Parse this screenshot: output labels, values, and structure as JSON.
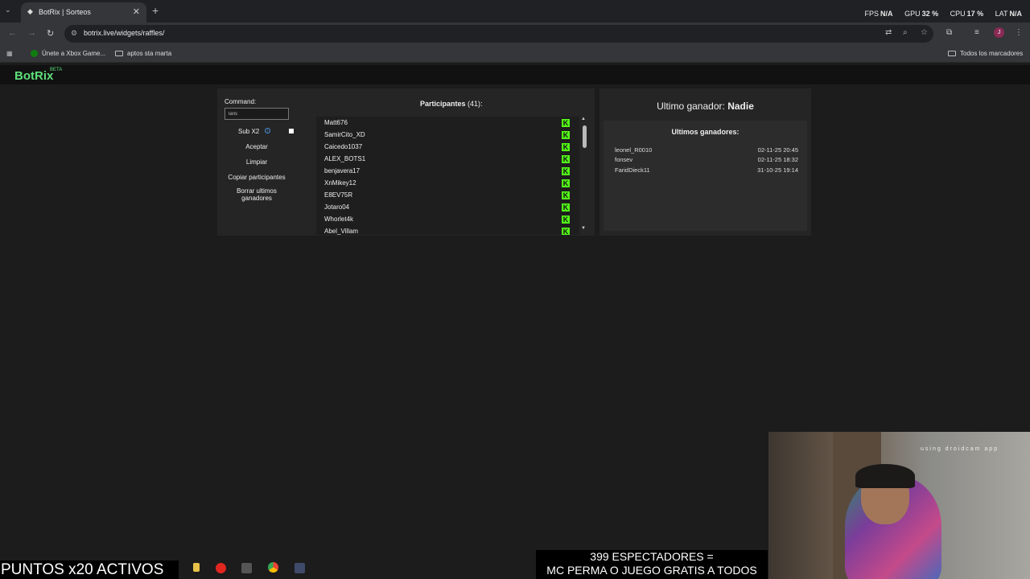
{
  "browser": {
    "tab_title": "BotRix | Sorteos",
    "url": "botrix.live/widgets/raffles/",
    "stats": [
      {
        "label": "FPS",
        "value": "N/A"
      },
      {
        "label": "GPU",
        "value": "32 %"
      },
      {
        "label": "CPU",
        "value": "17 %"
      },
      {
        "label": "LAT",
        "value": "N/A"
      }
    ],
    "bookmarks": {
      "xbox": "Únete a Xbox Game...",
      "folder1": "aptos sta marta",
      "all": "Todos los marcadores"
    },
    "avatar_letter": "J"
  },
  "app": {
    "logo": "BotRix",
    "beta": "BETA"
  },
  "left": {
    "command_label": "Command:",
    "command_value": "laris",
    "sub_x2_label": "Sub X2",
    "accept": "Aceptar",
    "clear": "Limpiar",
    "copy": "Copiar participantes",
    "delete": "Borrar ultimos ganadores"
  },
  "participants": {
    "title": "Participantes",
    "count": "(41)",
    "colon": ":",
    "names": [
      "Matt676",
      "SamirCito_XD",
      "Caicedo1037",
      "ALEX_BOTS1",
      "benjavera17",
      "XnMikey12",
      "E8EV75R",
      "Jotaro04",
      "Whorlet4k",
      "Abel_Villam"
    ]
  },
  "right": {
    "last_winner_label": "Ultimo ganador:",
    "last_winner_value": "Nadie",
    "winners_title": "Ultimos ganadores:",
    "winners": [
      {
        "name": "leonel_R0010",
        "date": "02-11-25 20:45"
      },
      {
        "name": "fonsev",
        "date": "02-11-25 18:32"
      },
      {
        "name": "FaridDieck11",
        "date": "31-10-25 19:14"
      }
    ]
  },
  "stream": {
    "left_overlay": "PUNTOS x20 ACTIVOS",
    "viewers_line1": "399 ESPECTADORES =",
    "viewers_line2": "MC PERMA O JUEGO GRATIS A TODOS",
    "webcam_text": "using droidcam app"
  },
  "colors": {
    "accent_green": "#5ee07a",
    "kick_green": "#53fc18",
    "panel": "#252525"
  }
}
